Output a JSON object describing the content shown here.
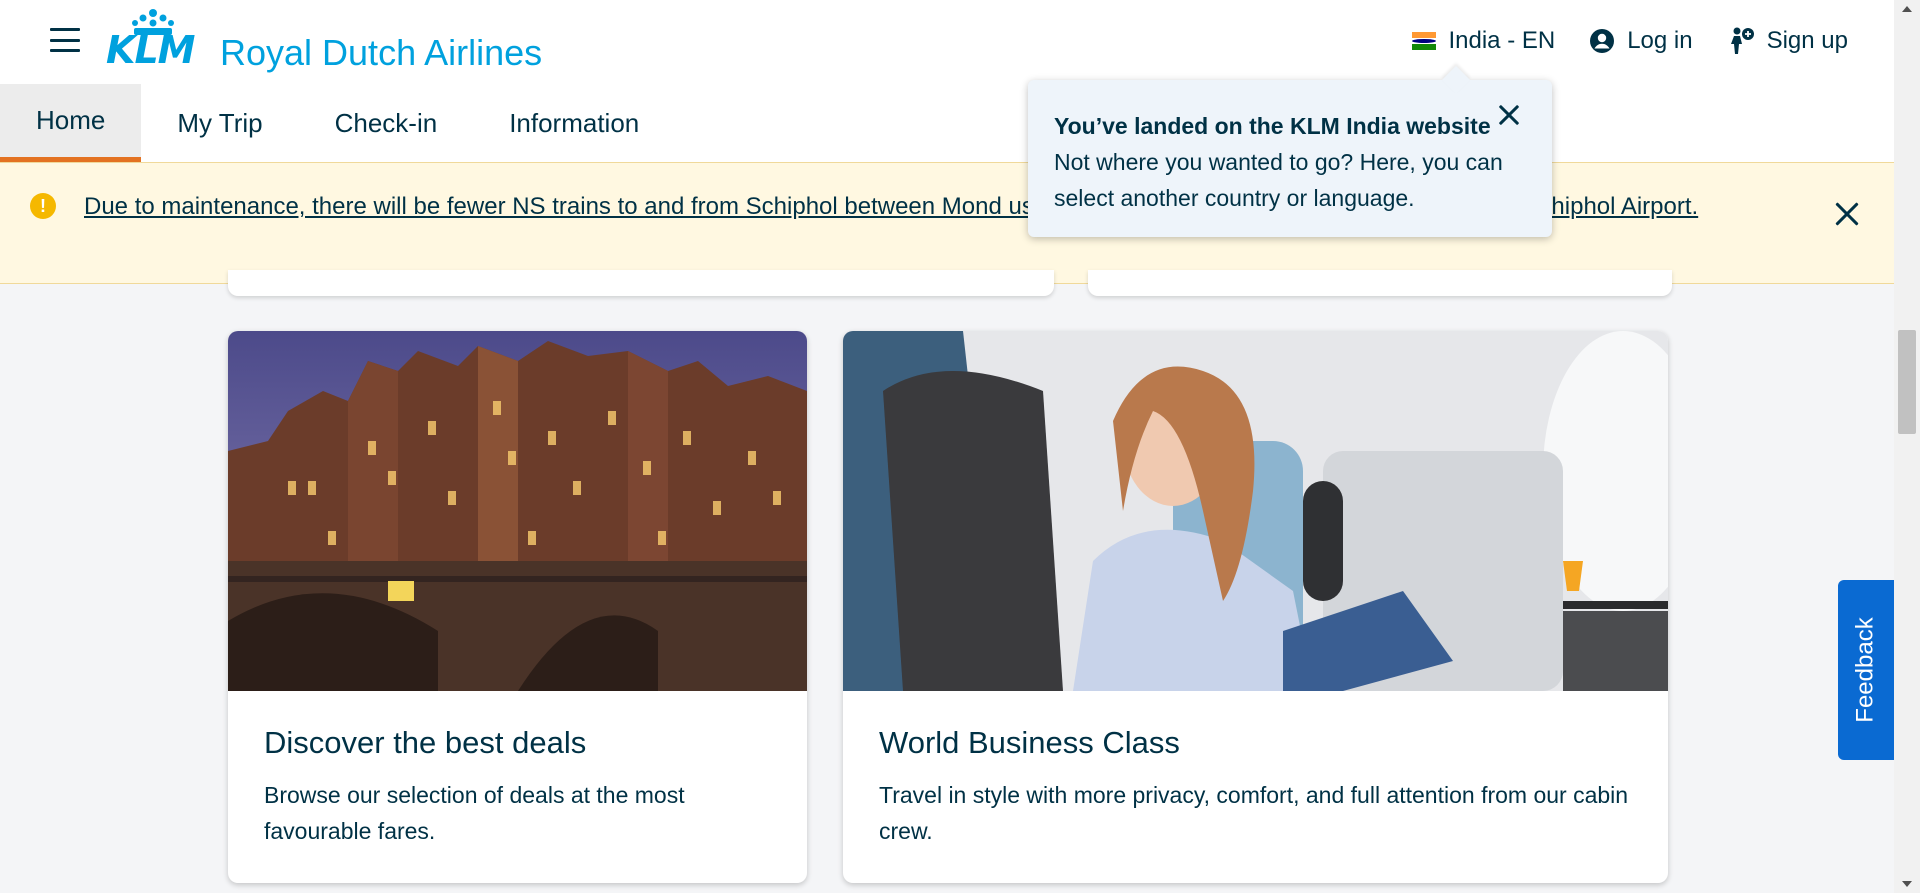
{
  "header": {
    "brand_text": "Royal Dutch Airlines",
    "logo_mark_text": "KLM",
    "locale_label": "India - EN",
    "login_label": "Log in",
    "signup_label": "Sign up",
    "brand_color": "#00a1de"
  },
  "nav": {
    "tabs": [
      {
        "label": "Home",
        "active": true
      },
      {
        "label": "My Trip",
        "active": false
      },
      {
        "label": "Check-in",
        "active": false
      },
      {
        "label": "Information",
        "active": false
      }
    ]
  },
  "notice": {
    "text": "Due to maintenance, there will be fewer NS trains to and from Schiphol between Mond ust your schedule if you are travelling by train to Schiphol Airport.",
    "color": "#fff8e1"
  },
  "popover": {
    "title": "You’ve landed on the KLM India website",
    "body": "Not where you wanted to go? Here, you can select another country or language."
  },
  "cards": [
    {
      "title": "Discover the best deals",
      "description": "Browse our selection of deals at the most favourable fares.",
      "image_subject": "amsterdam-canal-houses-at-night"
    },
    {
      "title": "World Business Class",
      "description": "Travel in style with more privacy, comfort, and full attention from our cabin crew.",
      "image_subject": "woman-reading-in-business-class-seat"
    }
  ],
  "feedback_label": "Feedback"
}
